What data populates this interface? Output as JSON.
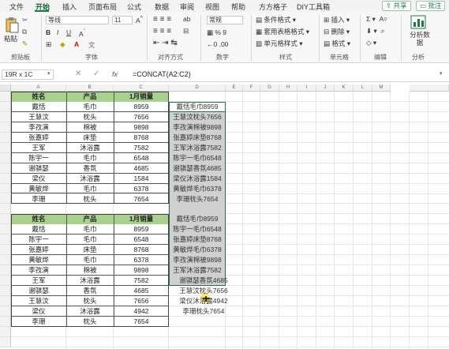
{
  "tabs": [
    "文件",
    "开始",
    "插入",
    "页面布局",
    "公式",
    "数据",
    "审阅",
    "视图",
    "帮助",
    "方方格子",
    "DIY工具箱"
  ],
  "active_tab": "开始",
  "share_label": "共享",
  "comment_label": "批注",
  "ribbon": {
    "paste_label": "粘贴",
    "font_name": "等线",
    "font_size": "11",
    "number_format": "常规",
    "cond_format": "条件格式",
    "table_format": "套用表格格式",
    "cell_style": "单元格样式",
    "insert": "插入",
    "delete": "删除",
    "format": "格式",
    "analyze": "分析数据",
    "groups": [
      "剪贴板",
      "字体",
      "对齐方式",
      "数字",
      "样式",
      "单元格",
      "编辑",
      "分析"
    ]
  },
  "formula_bar": {
    "name_box": "19R x 1C",
    "fx": "fx",
    "formula": "=CONCAT(A2:C2)"
  },
  "columns": [
    "A",
    "B",
    "C",
    "D",
    "E",
    "F",
    "G",
    "H",
    "I",
    "J",
    "K",
    "L",
    "M"
  ],
  "table1": {
    "headers": [
      "姓名",
      "产品",
      "1月销量"
    ],
    "rows": [
      [
        "戴恬",
        "毛巾",
        "8959"
      ],
      [
        "王慧汶",
        "枕头",
        "7656"
      ],
      [
        "李孜演",
        "棉被",
        "9898"
      ],
      [
        "张嘉婷",
        "床垫",
        "8768"
      ],
      [
        "王军",
        "沐浴露",
        "7582"
      ],
      [
        "陈宇一",
        "毛巾",
        "6548"
      ],
      [
        "谢骐瑟",
        "香氛",
        "4685"
      ],
      [
        "梁仪",
        "沐浴露",
        "1584"
      ],
      [
        "黄敏烨",
        "毛巾",
        "6378"
      ],
      [
        "李珊",
        "枕头",
        "7654"
      ]
    ]
  },
  "table2": {
    "headers": [
      "姓名",
      "产品",
      "1月销量"
    ],
    "rows": [
      [
        "戴恬",
        "毛巾",
        "8959"
      ],
      [
        "陈宇一",
        "毛巾",
        "6548"
      ],
      [
        "张嘉婷",
        "床垫",
        "8768"
      ],
      [
        "黄敏烨",
        "毛巾",
        "6378"
      ],
      [
        "李孜演",
        "棉被",
        "9898"
      ],
      [
        "王军",
        "沐浴露",
        "7582"
      ],
      [
        "谢骐瑟",
        "香氛",
        "4685"
      ],
      [
        "王慧汶",
        "枕头",
        "7656"
      ],
      [
        "梁仪",
        "沐浴露",
        "4942"
      ],
      [
        "李珊",
        "枕头",
        "7654"
      ]
    ]
  },
  "concat_results": [
    "戴恬毛巾8959",
    "王慧汶枕头7656",
    "李孜演棉被9898",
    "张嘉婷床垫8768",
    "王军沐浴露7582",
    "陈宇一毛巾6548",
    "谢骐瑟香氛4685",
    "梁仪沐浴露1584",
    "黄敏烨毛巾6378",
    "李珊枕头7654",
    "",
    "戴恬毛巾8959",
    "陈宇一毛巾6548",
    "张嘉婷床垫8768",
    "黄敏烨毛巾6378",
    "李孜演棉被9898",
    "王军沐浴露7582",
    "谢骐瑟香氛4685",
    "王慧汶枕头7656",
    "梁仪沐浴露4942",
    "李珊枕头7654"
  ],
  "colors": {
    "header_fill": "#a9d18e",
    "selection_fill": "#d0d0d0",
    "selection_border": "#217346",
    "accent": "#1f7a45"
  }
}
